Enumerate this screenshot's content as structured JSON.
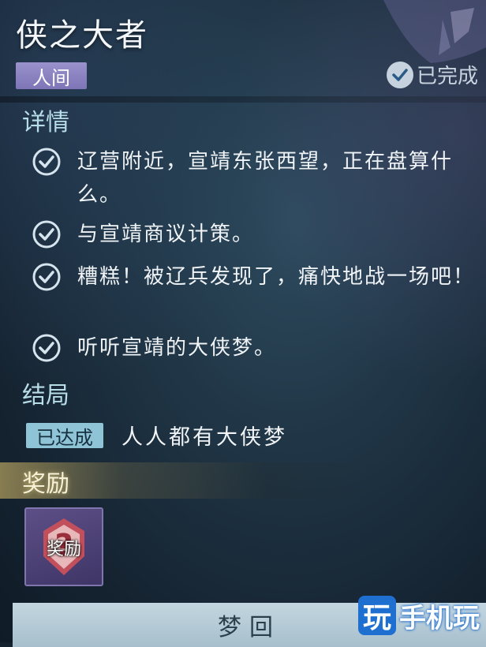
{
  "header": {
    "title": "侠之大者",
    "realm_tag": "人间",
    "status_text": "已完成"
  },
  "details": {
    "section_title": "详情",
    "items": [
      {
        "text": "辽营附近，宣靖东张西望，正在盘算什么。"
      },
      {
        "text": "与宣靖商议计策。"
      },
      {
        "text": "糟糕！被辽兵发现了，痛快地战一场吧！"
      },
      {
        "text": "听听宣靖的大侠梦。"
      }
    ]
  },
  "ending": {
    "section_title": "结局",
    "badge": "已达成",
    "name": "人人都有大侠梦"
  },
  "rewards": {
    "section_title": "奖励",
    "card_label": "奖励"
  },
  "actions": {
    "dream_back_label": "梦回"
  },
  "watermark": {
    "logo_char": "玩",
    "text": "手机玩"
  },
  "colors": {
    "background": "#1f3444",
    "section_title": "#b7dde8",
    "realm_tag": "#8c84c2",
    "achieved_badge": "#8fc4d6",
    "button": "#b5cad6"
  },
  "icons": {
    "complete": "check-circle-icon",
    "detail": "check-circle-outline-icon",
    "reward": "question-emblem-icon",
    "decoration": "butterfly-icon"
  }
}
